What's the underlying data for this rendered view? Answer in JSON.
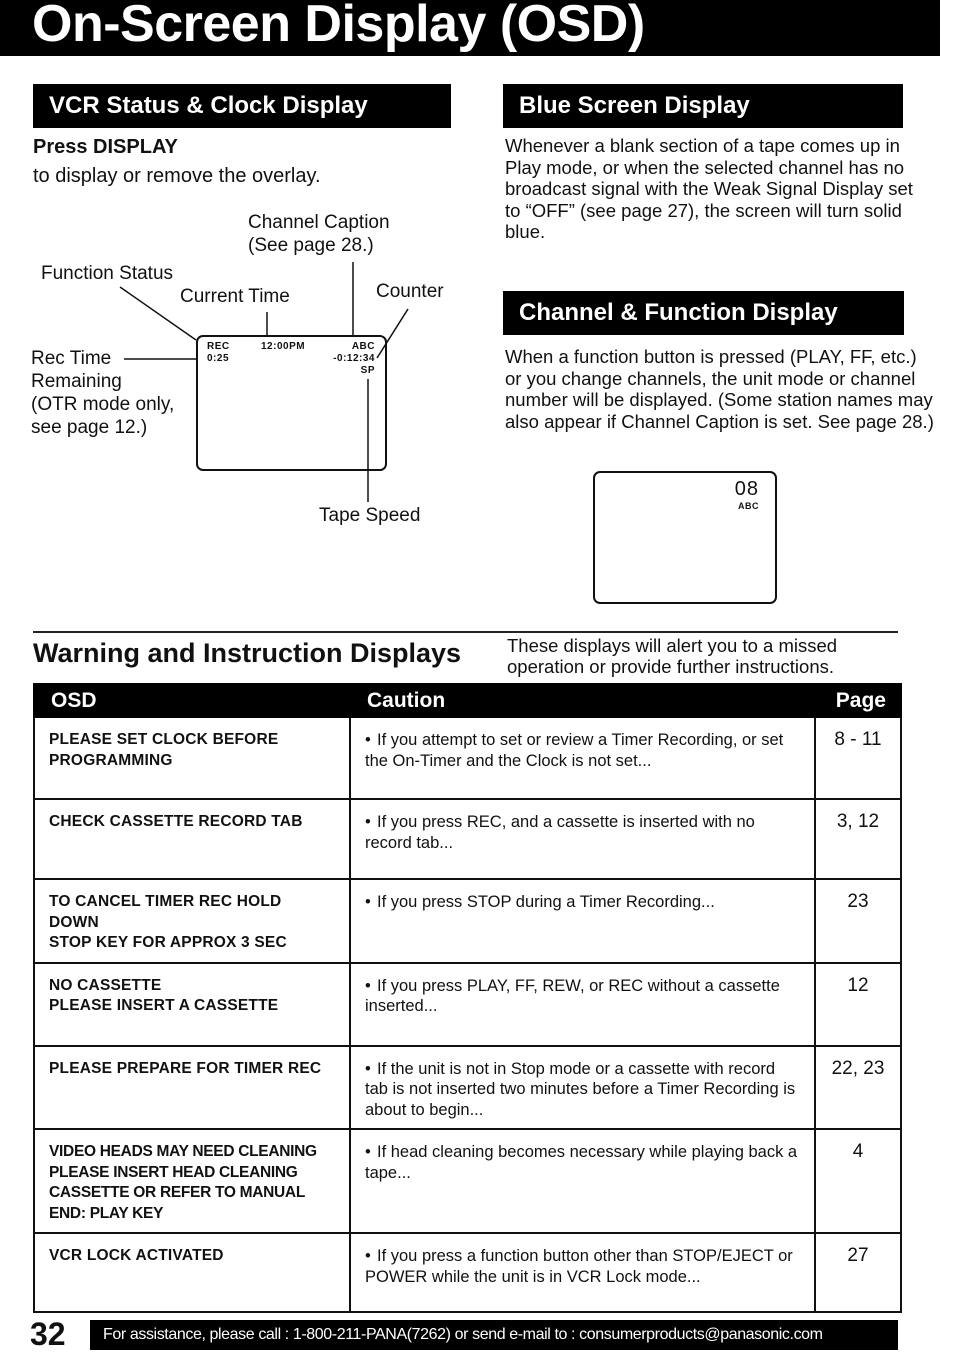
{
  "page_title": "On-Screen Display (OSD)",
  "vcr_section": {
    "heading": "VCR Status & Clock Display",
    "press_label": "Press DISPLAY",
    "press_sub": "to display or remove the overlay.",
    "labels": {
      "channel_caption": "Channel  Caption",
      "channel_caption_ref": "(See page 28.)",
      "function_status": "Function Status",
      "current_time": "Current Time",
      "counter": "Counter",
      "rec_time_1": "Rec Time",
      "rec_time_2": "Remaining",
      "rec_time_3": "(OTR mode only,",
      "rec_time_4": "see page 12.)",
      "tape_speed": "Tape  Speed"
    },
    "screen": {
      "function": "REC",
      "time": "12:00PM",
      "caption": "ABC",
      "rec_remaining": "0:25",
      "counter": "-0:12:34",
      "speed": "SP"
    }
  },
  "blue_section": {
    "heading": "Blue Screen Display",
    "text": "Whenever a blank section of a tape comes up in Play mode, or when the selected channel has no broadcast signal with the Weak Signal Display set to “OFF” (see page 27), the screen will turn solid blue."
  },
  "channel_section": {
    "heading": "Channel & Function Display",
    "text": "When a function button is pressed (PLAY, FF, etc.) or you change channels, the unit mode or channel number will be displayed. (Some station names may also appear if Channel Caption is set. See page 28.)",
    "screen": {
      "channel": "08",
      "caption": "ABC"
    }
  },
  "warning_section": {
    "title": "Warning and Instruction Displays",
    "description": "These displays will alert you to a missed operation or provide further instructions.",
    "columns": [
      "OSD",
      "Caution",
      "Page"
    ],
    "rows": [
      {
        "osd": "PLEASE SET CLOCK BEFORE\nPROGRAMMING",
        "caution": "If you attempt to set or review a Timer Recording, or set the On-Timer and the Clock is not set...",
        "page": "8 - 11"
      },
      {
        "osd": "CHECK CASSETTE RECORD TAB",
        "caution": "If you press REC, and a cassette is inserted with no record tab...",
        "page": "3, 12"
      },
      {
        "osd": "TO CANCEL TIMER REC HOLD DOWN\nSTOP KEY FOR APPROX 3 SEC",
        "caution": "If you press STOP during a Timer Recording...",
        "page": "23"
      },
      {
        "osd": "NO CASSETTE\nPLEASE INSERT A CASSETTE",
        "caution": "If you press PLAY, FF, REW, or REC without a cassette inserted...",
        "page": "12"
      },
      {
        "osd": "PLEASE PREPARE FOR TIMER REC",
        "caution": "If the unit is not in Stop mode or a cassette with record tab is not inserted two minutes before a Timer Recording is about to begin...",
        "page": "22, 23"
      },
      {
        "osd": "VIDEO HEADS MAY NEED CLEANING\nPLEASE INSERT HEAD CLEANING\nCASSETTE OR REFER TO MANUAL\nEND: PLAY KEY",
        "caution": "If head cleaning becomes necessary while playing back a tape...",
        "page": "4"
      },
      {
        "osd": "VCR LOCK ACTIVATED",
        "caution": "If you press a function button other than STOP/EJECT or POWER while the unit is in VCR Lock mode...",
        "page": "27"
      }
    ],
    "bullet": "•"
  },
  "footer": {
    "page_number": "32",
    "assistance": "For assistance, please call : 1-800-211-PANA(7262) or send e-mail to : consumerproducts@panasonic.com"
  }
}
